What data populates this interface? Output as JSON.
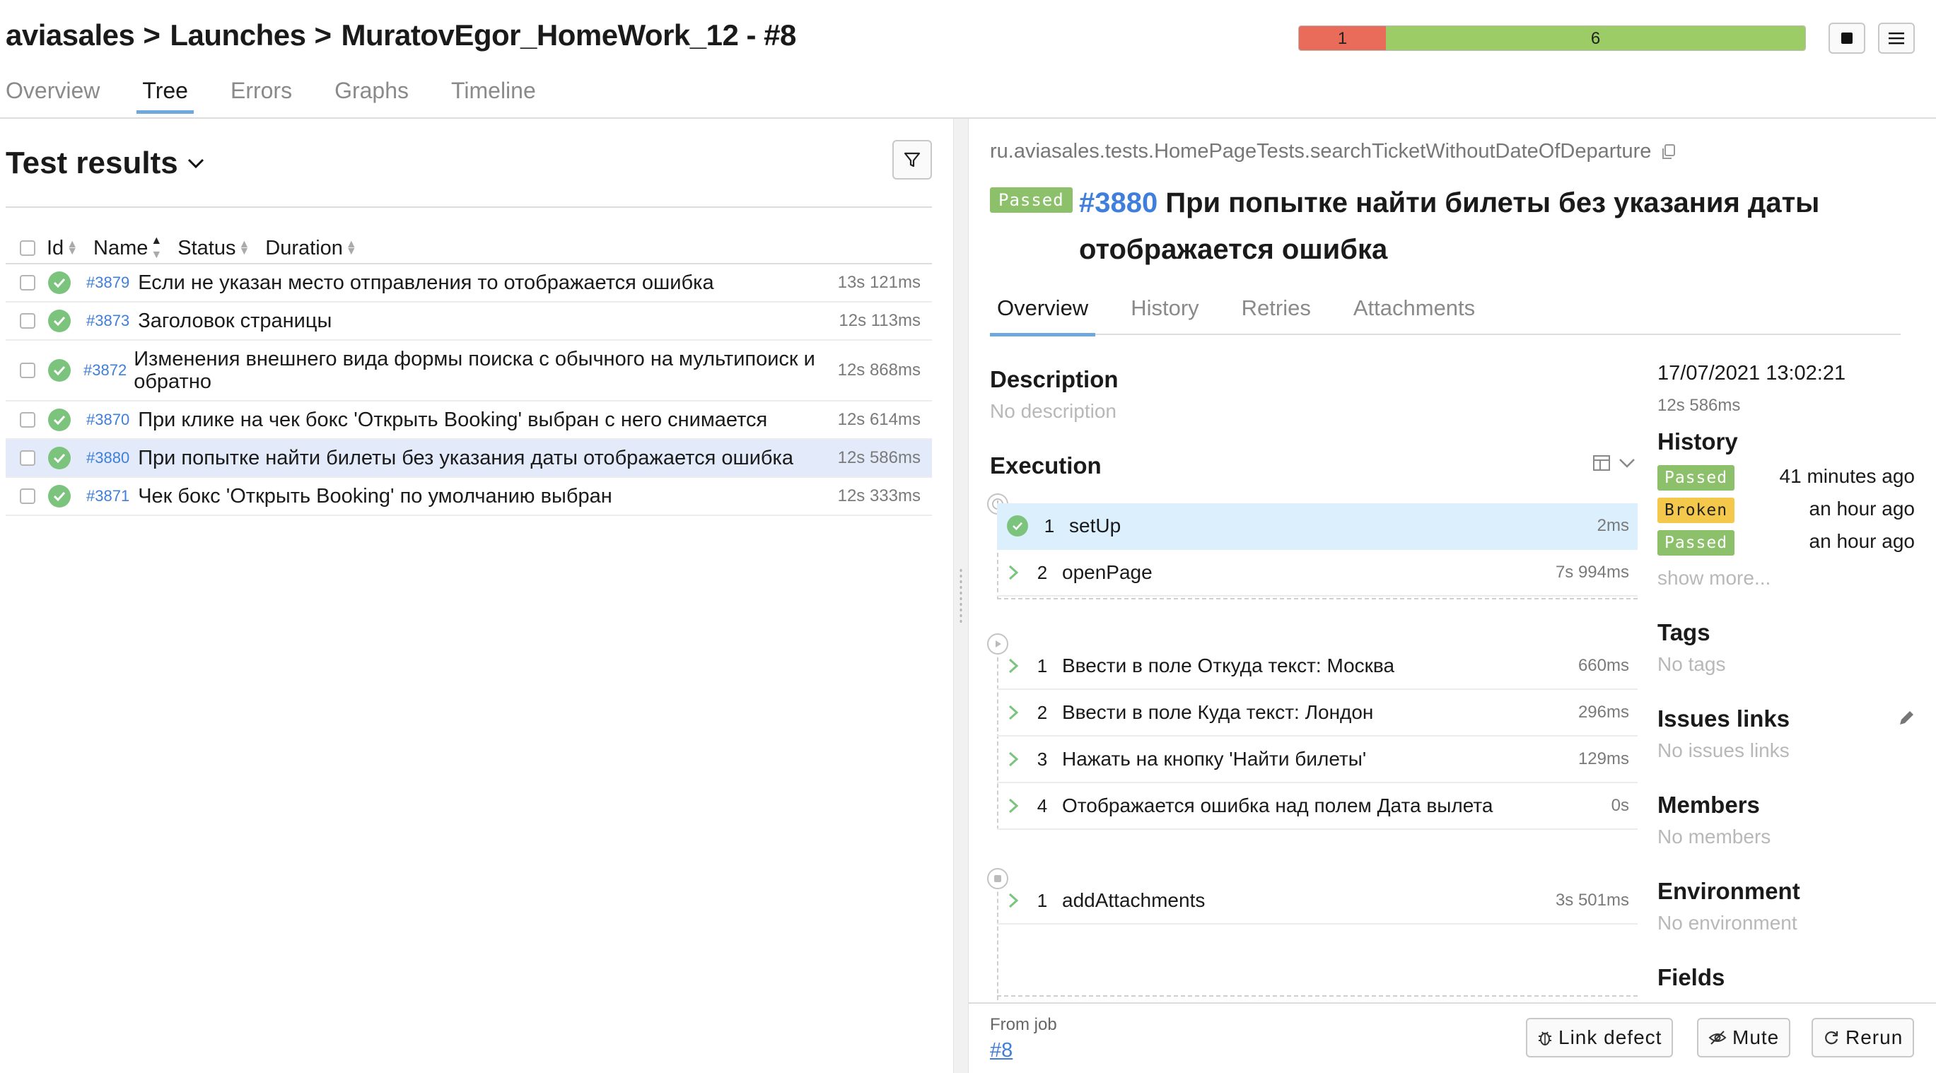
{
  "header": {
    "breadcrumb": [
      "aviasales",
      "Launches",
      "MuratovEgor_HomeWork_12 - #8"
    ],
    "separator": ">",
    "stats": {
      "failed": "1",
      "passed": "6"
    },
    "tabs": [
      "Overview",
      "Tree",
      "Errors",
      "Graphs",
      "Timeline"
    ],
    "active_tab": "Tree"
  },
  "left": {
    "title": "Test results",
    "columns": [
      "Id",
      "Name",
      "Status",
      "Duration"
    ],
    "rows": [
      {
        "id": "#3879",
        "name": "Если не указан место отправления то отображается ошибка",
        "duration": "13s 121ms",
        "status": "passed"
      },
      {
        "id": "#3873",
        "name": "Заголовок страницы",
        "duration": "12s 113ms",
        "status": "passed"
      },
      {
        "id": "#3872",
        "name": "Изменения внешнего вида формы поиска с обычного на мультипоиск и обратно",
        "duration": "12s 868ms",
        "status": "passed"
      },
      {
        "id": "#3870",
        "name": "При клике на чек бокс 'Открыть Booking' выбран с него снимается",
        "duration": "12s 614ms",
        "status": "passed"
      },
      {
        "id": "#3880",
        "name": "При попытке найти билеты без указания даты отображается ошибка",
        "duration": "12s 586ms",
        "status": "passed",
        "selected": true
      },
      {
        "id": "#3871",
        "name": "Чек бокс 'Открыть Booking' по умолчанию выбран",
        "duration": "12s 333ms",
        "status": "passed"
      }
    ]
  },
  "right": {
    "full_name": "ru.aviasales.tests.HomePageTests.searchTicketWithoutDateOfDeparture",
    "status": "Passed",
    "test_id": "#3880",
    "test_title": "При попытке найти билеты без указания даты отображается ошибка",
    "tabs": [
      "Overview",
      "History",
      "Retries",
      "Attachments"
    ],
    "active_tab": "Overview",
    "description_title": "Description",
    "description_text": "No description",
    "execution_title": "Execution",
    "setup_steps": [
      {
        "num": "1",
        "name": "setUp",
        "duration": "2ms",
        "status": "passed"
      },
      {
        "num": "2",
        "name": "openPage",
        "duration": "7s 994ms",
        "status": "expandable"
      }
    ],
    "test_steps": [
      {
        "num": "1",
        "name": "Ввести в поле Откуда текст: Москва",
        "duration": "660ms"
      },
      {
        "num": "2",
        "name": "Ввести в поле Куда текст: Лондон",
        "duration": "296ms"
      },
      {
        "num": "3",
        "name": "Нажать на кнопку 'Найти билеты'",
        "duration": "129ms"
      },
      {
        "num": "4",
        "name": "Отображается ошибка над полем Дата вылета",
        "duration": "0s"
      }
    ],
    "teardown_steps": [
      {
        "num": "1",
        "name": "addAttachments",
        "duration": "3s 501ms"
      }
    ],
    "sidebar": {
      "date": "17/07/2021 13:02:21",
      "duration": "12s 586ms",
      "history_title": "History",
      "history": [
        {
          "status": "Passed",
          "time": "41 minutes ago",
          "color": "#8cc06a"
        },
        {
          "status": "Broken",
          "time": "an hour ago",
          "color": "#f3c84b"
        },
        {
          "status": "Passed",
          "time": "an hour ago",
          "color": "#8cc06a"
        }
      ],
      "show_more": "show more...",
      "tags_title": "Tags",
      "tags_text": "No tags",
      "issues_title": "Issues links",
      "issues_text": "No issues links",
      "members_title": "Members",
      "members_text": "No members",
      "environment_title": "Environment",
      "environment_text": "No environment",
      "fields_title": "Fields"
    },
    "footer": {
      "from_job_label": "From job",
      "job_link": "#8",
      "link_defect": "Link defect",
      "mute": "Mute",
      "rerun": "Rerun"
    }
  },
  "colors": {
    "accent": "#6fa8dc",
    "link": "#3f7fdb",
    "passed": "#8cc06a",
    "failed": "#e96c5b",
    "broken": "#f3c84b"
  }
}
